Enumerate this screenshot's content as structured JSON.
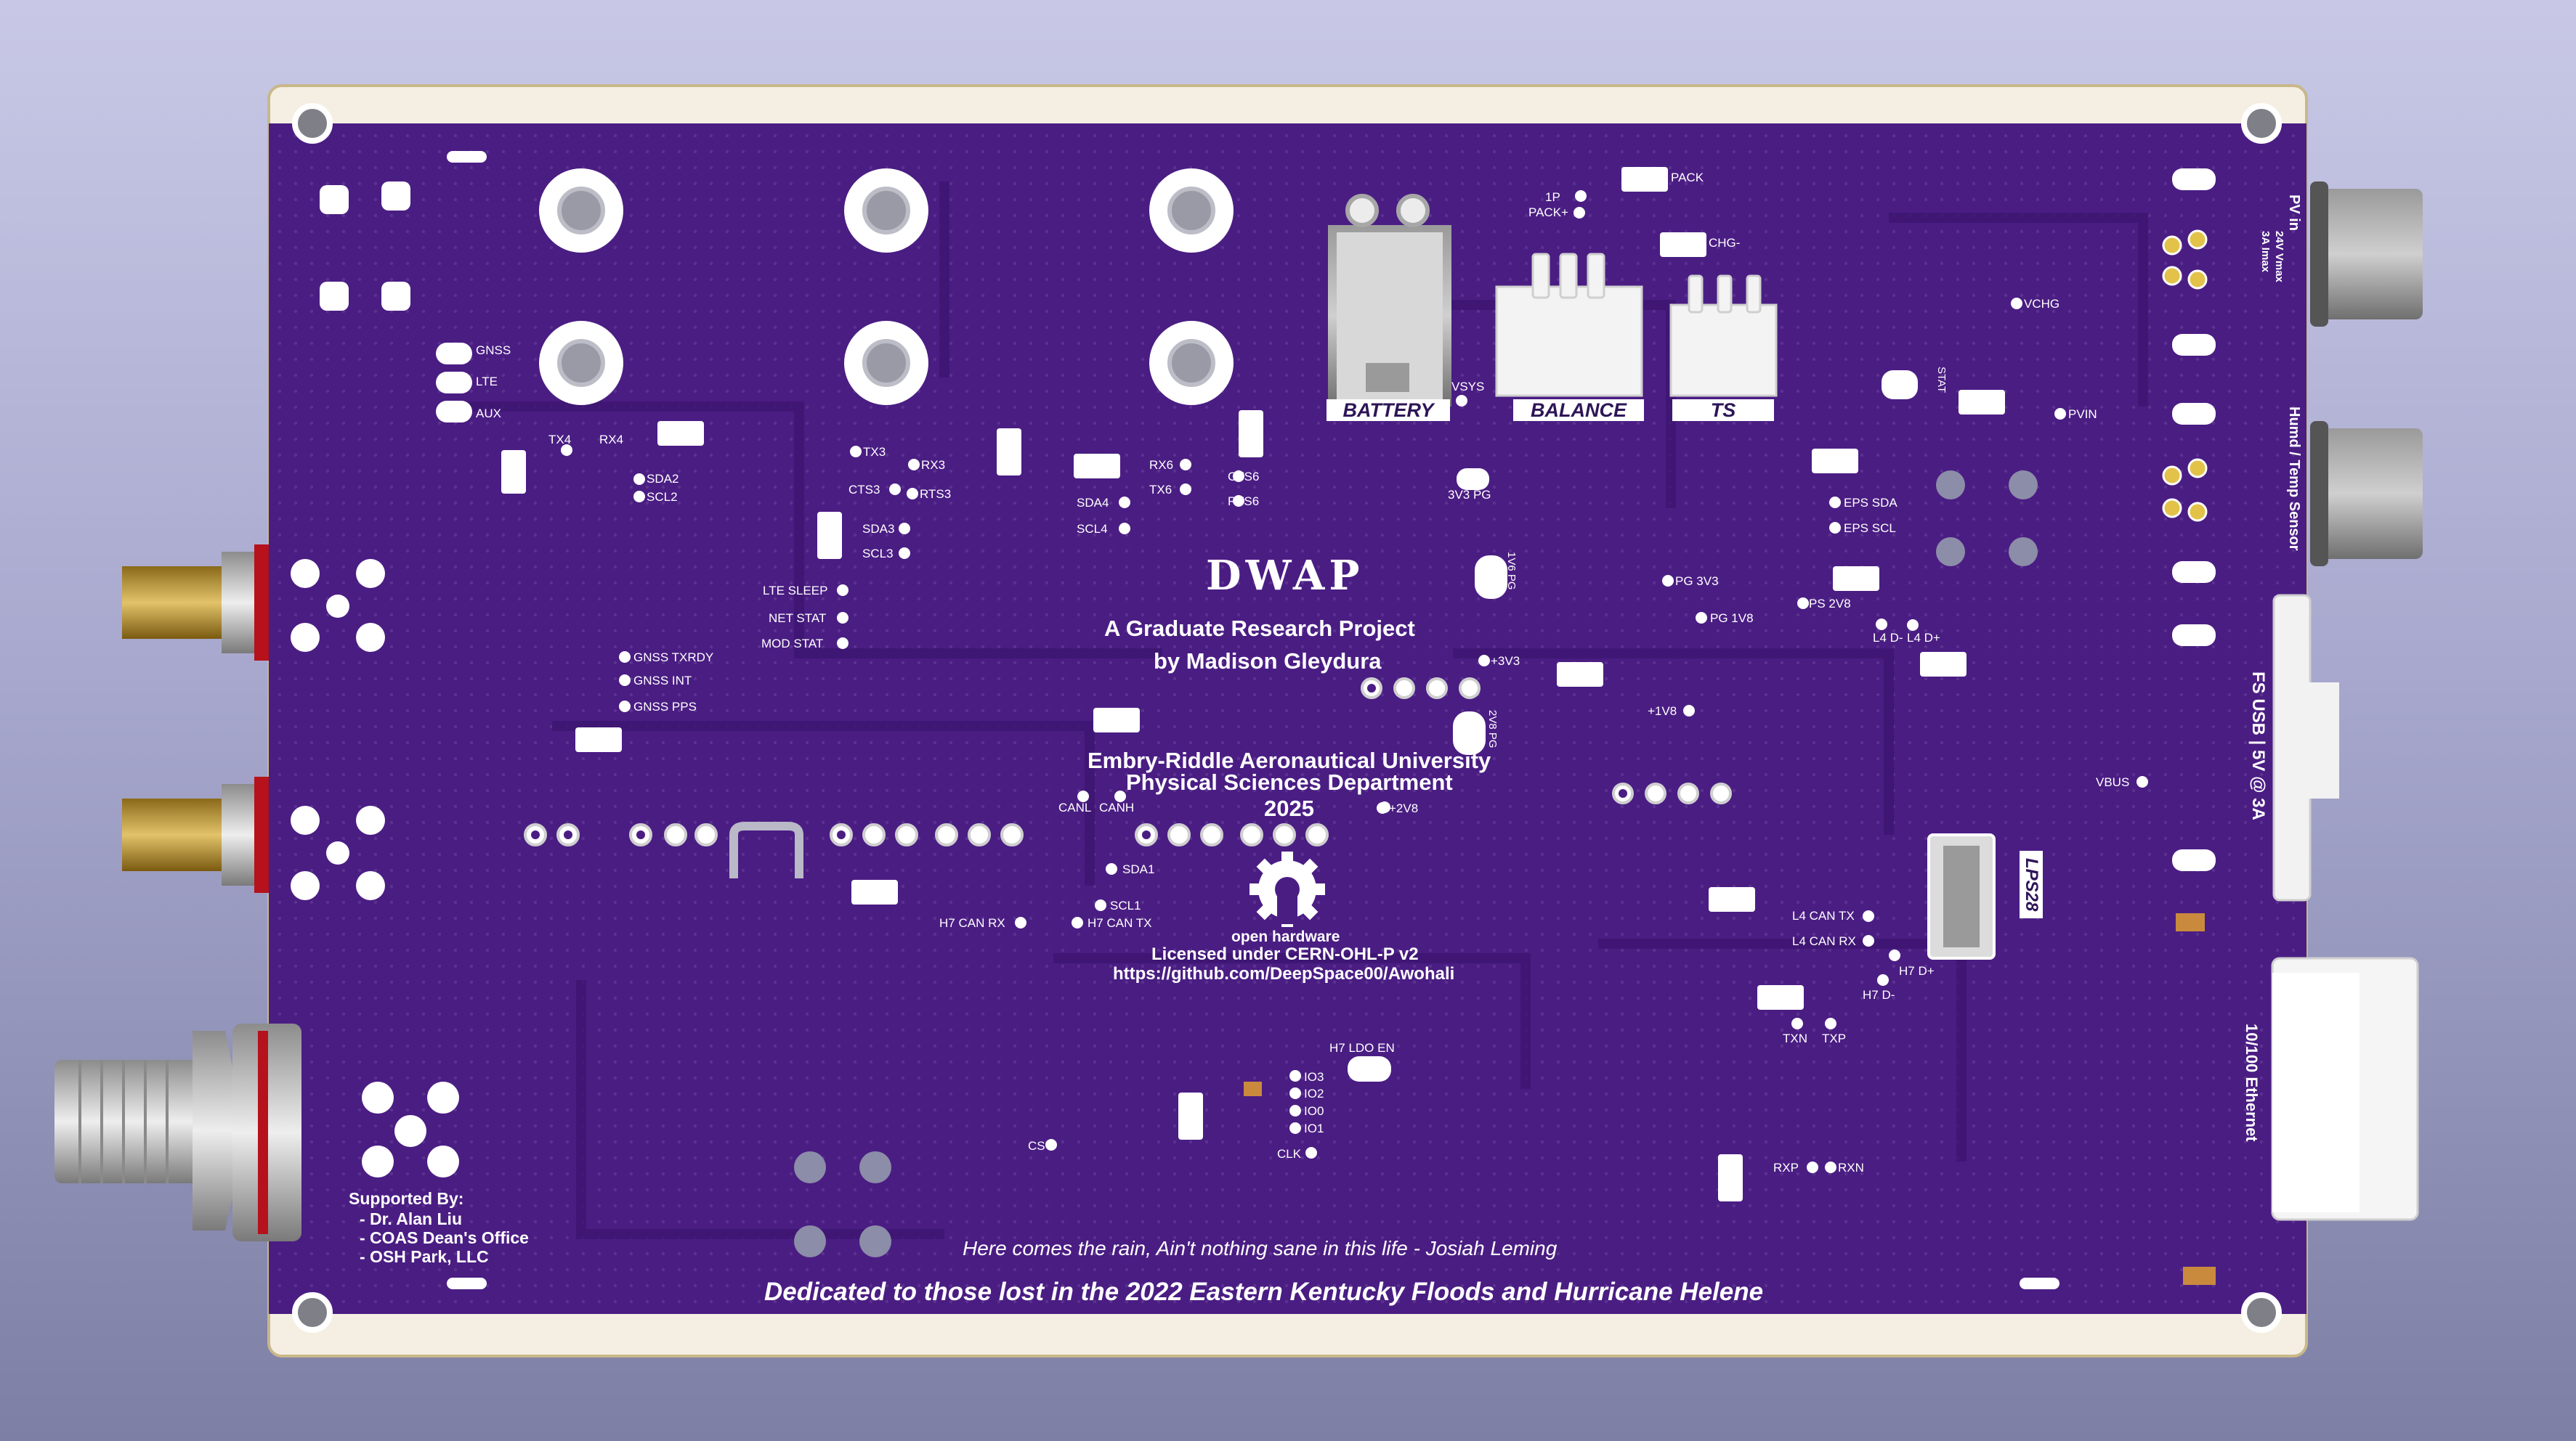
{
  "colors": {
    "board": "#4a1d83",
    "mask_dark": "#3a1568",
    "silk": "#ffffff",
    "pad": "#e8e6de",
    "gold": "#c9a227"
  },
  "logo": {
    "text": "DWAP"
  },
  "title": {
    "line1": "A Graduate Research Project",
    "line2": "by Madison Gleydura"
  },
  "institution": {
    "line1": "Embry-Riddle Aeronautical University",
    "line2": "Physical Sciences Department",
    "year": "2025"
  },
  "open_hardware": {
    "icon": "open-hardware-gear-icon",
    "label": "open hardware",
    "license": "Licensed under CERN-OHL-P v2",
    "url": "https://github.com/DeepSpace00/Awohali"
  },
  "supported_by": {
    "heading": "Supported By:",
    "lines": [
      "- Dr. Alan Liu",
      "- COAS Dean's Office",
      "- OSH Park, LLC"
    ]
  },
  "quote": "Here comes the rain, Ain't nothing sane in this life - Josiah Leming",
  "dedication": "Dedicated to those lost in the 2022 Eastern Kentucky Floods and Hurricane Helene",
  "connectors": {
    "battery": "BATTERY",
    "balance": "BALANCE",
    "ts": "TS",
    "lps": "LPS28"
  },
  "edge_labels": {
    "pv_in": "PV in",
    "pv_spec1": "24V Vmax",
    "pv_spec2": "3A Imax",
    "hum_temp": "Humd / Temp Sensor",
    "usb": "FS USB | 5V @ 3A",
    "ethernet": "10/100 Ethernet"
  },
  "labels": {
    "gnss": "GNSS",
    "lte": "LTE",
    "aux": "AUX",
    "tx4": "TX4",
    "rx4": "RX4",
    "sda2": "SDA2",
    "scl2": "SCL2",
    "tx3": "TX3",
    "rx3": "RX3",
    "cts3": "CTS3",
    "rts3": "RTS3",
    "sda3": "SDA3",
    "scl3": "SCL3",
    "sda4": "SDA4",
    "scl4": "SCL4",
    "rx6": "RX6",
    "tx6": "TX6",
    "cts6": "CTS6",
    "rts6": "RTS6",
    "vsys": "VSYS",
    "pg3v3": "3V3 PG",
    "pg1v6": "1V6 PG",
    "pg2v8": "2V8 PG",
    "plus3v3": "+3V3",
    "plus1v8": "+1V8",
    "plus2v8": "+2V8",
    "pack": "PACK",
    "pack_plus": "PACK+",
    "onep": "1P",
    "chg": "CHG-",
    "vchg": "VCHG",
    "stat": "STAT",
    "pvin": "PVIN",
    "eps_sda": "EPS SDA",
    "eps_scl": "EPS SCL",
    "pg_3v3": "PG 3V3",
    "pg_1v8": "PG 1V8",
    "ps_2v8": "PS 2V8",
    "l4dm": "L4 D-",
    "l4dp": "L4 D+",
    "vbus": "VBUS",
    "lte_sleep": "LTE SLEEP",
    "net_stat": "NET STAT",
    "mod_stat": "MOD STAT",
    "gnss_txrdy": "GNSS TXRDY",
    "gnss_int": "GNSS INT",
    "gnss_pps": "GNSS PPS",
    "canl": "CANL",
    "canh": "CANH",
    "sda1": "SDA1",
    "scl1": "SCL1",
    "h7canrx": "H7 CAN RX",
    "h7cantx": "H7 CAN TX",
    "l4cantx": "L4 CAN TX",
    "l4canrx": "L4 CAN RX",
    "h7dp": "H7 D+",
    "h7dm": "H7 D-",
    "txn": "TXN",
    "txp": "TXP",
    "rxp": "RXP",
    "rxn": "RXN",
    "h7ldo": "H7 LDO EN",
    "io3": "IO3",
    "io2": "IO2",
    "io0": "IO0",
    "io1": "IO1",
    "clk": "CLK",
    "cs": "CS"
  }
}
